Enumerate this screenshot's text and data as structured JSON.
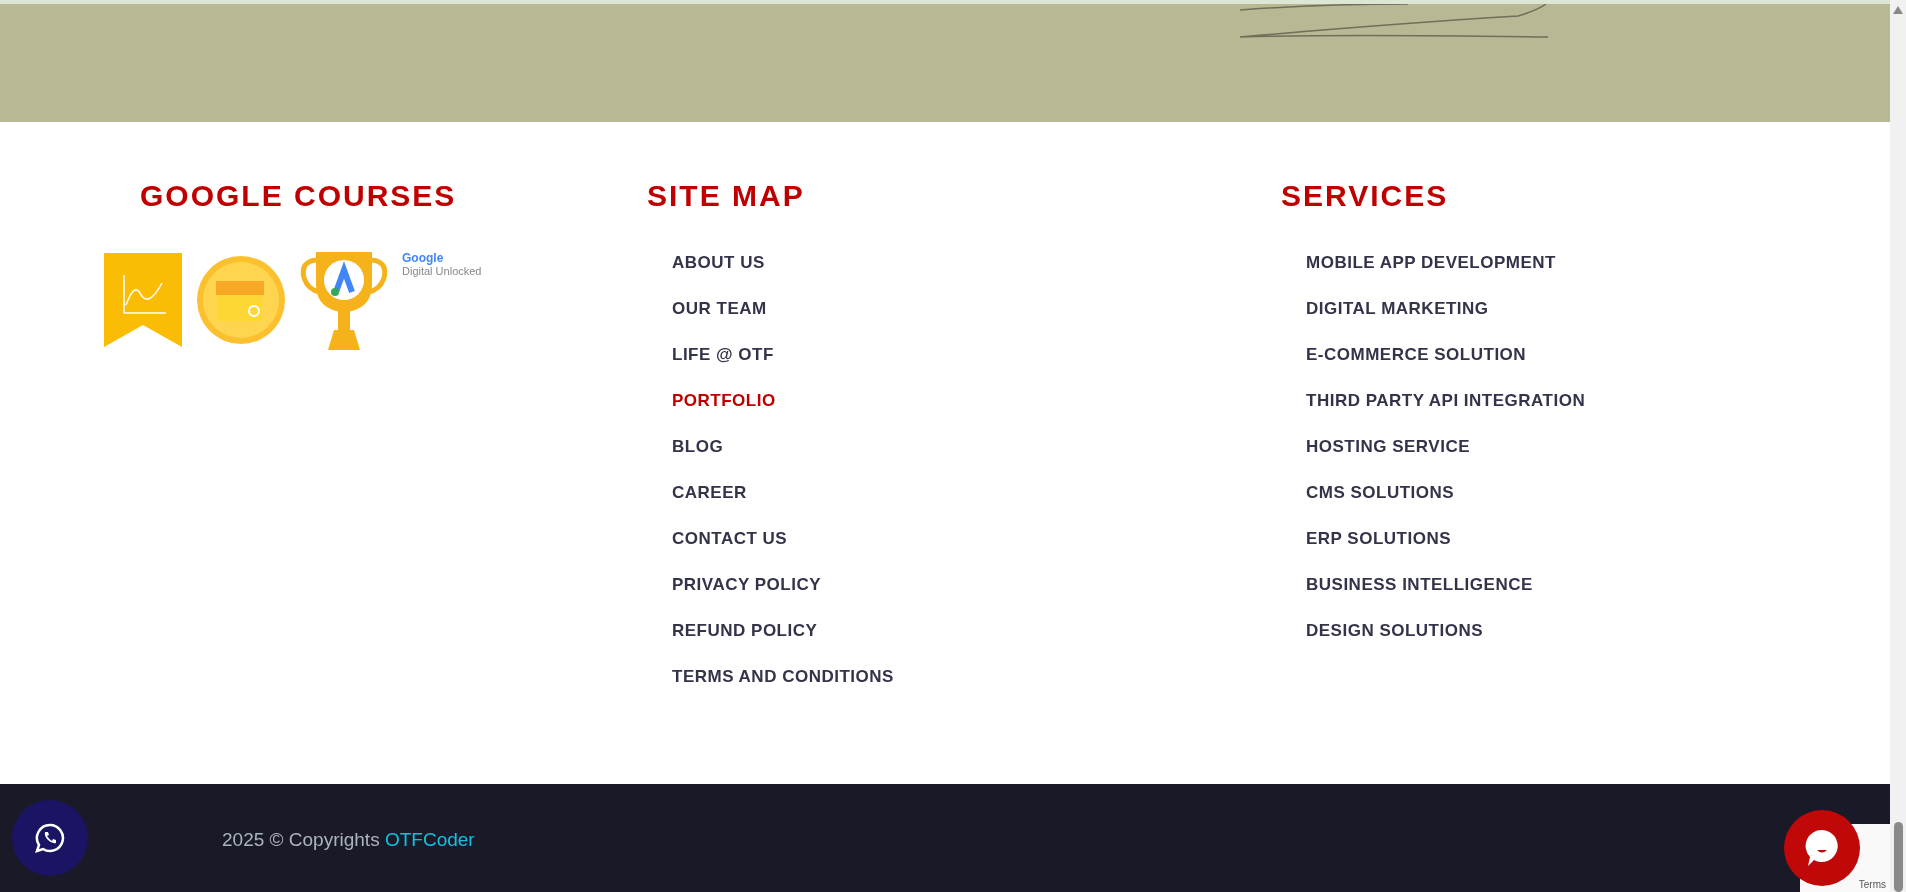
{
  "google_courses": {
    "title": "GOOGLE COURSES",
    "badge_caption": {
      "brand": "Google",
      "subtitle": "Digital Unlocked"
    }
  },
  "site_map": {
    "title": "SITE MAP",
    "links": [
      {
        "label": "ABOUT US",
        "selected": false
      },
      {
        "label": "OUR TEAM",
        "selected": false
      },
      {
        "label": "LIFE @ OTF",
        "selected": false
      },
      {
        "label": "PORTFOLIO",
        "selected": true
      },
      {
        "label": "BLOG",
        "selected": false
      },
      {
        "label": "CAREER",
        "selected": false
      },
      {
        "label": "CONTACT US",
        "selected": false
      },
      {
        "label": "PRIVACY POLICY",
        "selected": false
      },
      {
        "label": "REFUND POLICY",
        "selected": false
      },
      {
        "label": "TERMS AND CONDITIONS",
        "selected": false
      }
    ]
  },
  "services": {
    "title": "SERVICES",
    "links": [
      {
        "label": "MOBILE APP DEVELOPMENT",
        "selected": false
      },
      {
        "label": "DIGITAL MARKETING",
        "selected": false
      },
      {
        "label": "E-COMMERCE SOLUTION",
        "selected": false
      },
      {
        "label": "THIRD PARTY API INTEGRATION",
        "selected": false
      },
      {
        "label": "HOSTING SERVICE",
        "selected": false
      },
      {
        "label": "CMS SOLUTIONS",
        "selected": false
      },
      {
        "label": "ERP SOLUTIONS",
        "selected": false
      },
      {
        "label": "BUSINESS INTELLIGENCE",
        "selected": false
      },
      {
        "label": "DESIGN SOLUTIONS",
        "selected": false
      }
    ]
  },
  "copyright": {
    "text": "2025 © Copyrights",
    "link": "OTFCoder"
  },
  "recaptcha": {
    "text": "Terms"
  }
}
